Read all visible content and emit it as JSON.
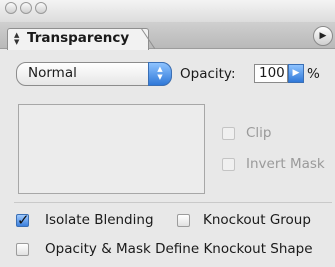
{
  "panel": {
    "tab_label": "Transparency",
    "blend_mode": "Normal",
    "opacity_label": "Opacity:",
    "opacity_value": "100",
    "opacity_unit": "%"
  },
  "options": {
    "clip_label": "Clip",
    "invert_mask_label": "Invert Mask",
    "isolate_blending_label": "Isolate Blending",
    "isolate_blending_checked": true,
    "knockout_group_label": "Knockout Group",
    "knockout_group_checked": false,
    "opacity_mask_label": "Opacity & Mask Define Knockout Shape",
    "opacity_mask_checked": false
  },
  "colors": {
    "accent": "#2f78d8",
    "panel_bg": "#e8e8e8"
  }
}
